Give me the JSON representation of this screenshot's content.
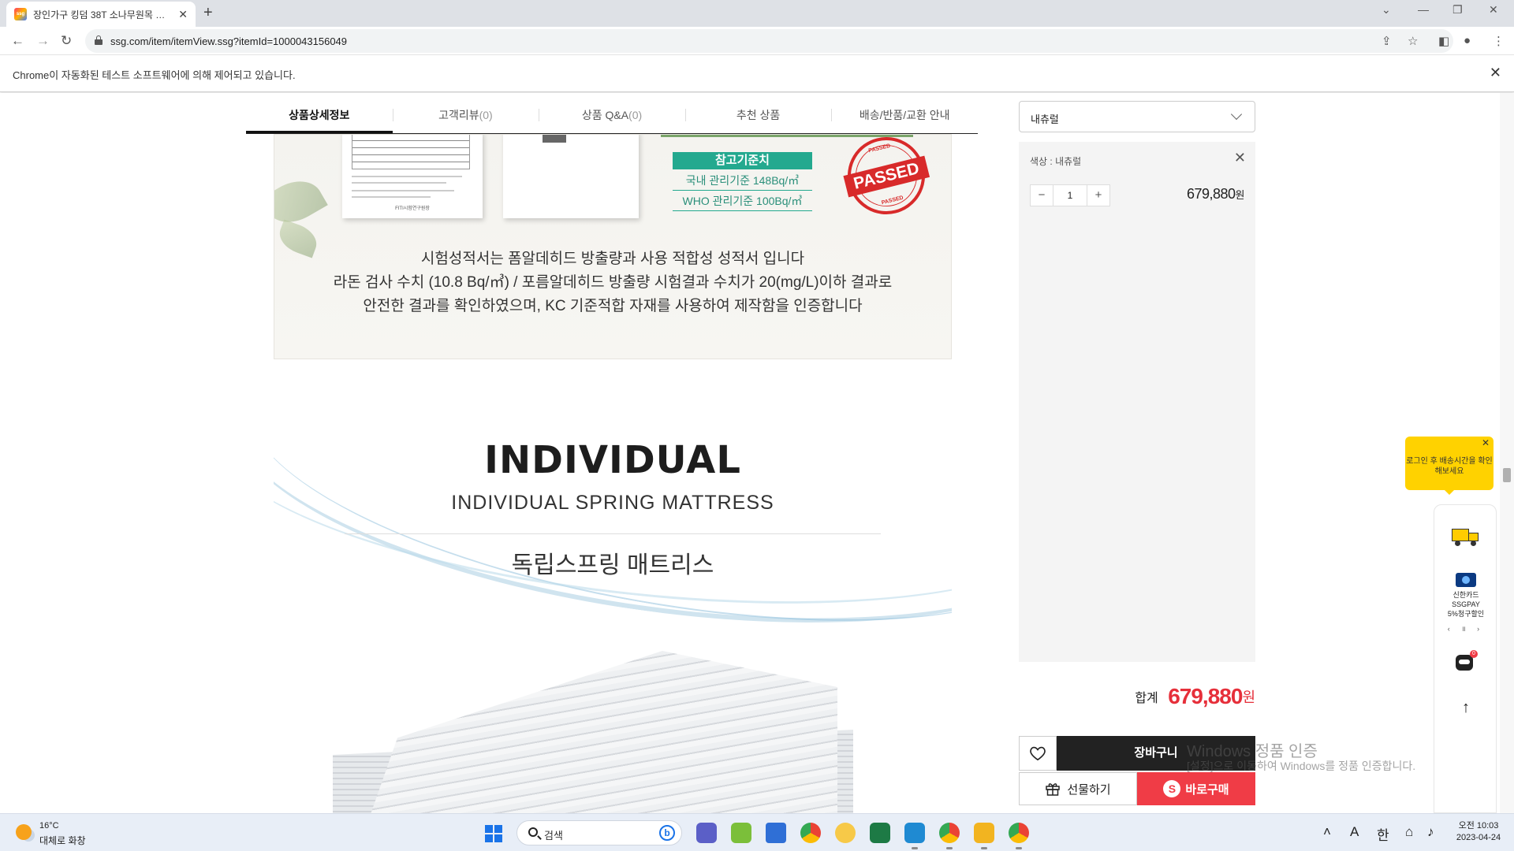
{
  "browser": {
    "tab_title": "장인가구 킹덤 38T 소나무원목 …",
    "favicon_text": "ssg",
    "url": "ssg.com/item/itemView.ssg?itemId=1000043156049",
    "infobar_message": "Chrome이 자동화된 테스트 소프트웨어에 의해 제어되고 있습니다.",
    "icons": [
      "back-icon",
      "forward-icon",
      "reload-icon",
      "lock-icon",
      "share-icon",
      "bookmark-star-icon",
      "side-panel-icon",
      "profile-icon",
      "menu-icon"
    ]
  },
  "product_tabs": [
    {
      "label": "상품상세정보",
      "active": true
    },
    {
      "label": "고객리뷰",
      "count": "(0)"
    },
    {
      "label": "상품 Q&A",
      "count": "(0)"
    },
    {
      "label": "추천 상품"
    },
    {
      "label": "배송/반품/교환 안내"
    }
  ],
  "certificate": {
    "ref_header": "참고기준치",
    "ref_domestic": "국내 관리기준 148Bq/㎥",
    "ref_who": "WHO 관리기준 100Bq/㎥",
    "stamp_text": "PASSED",
    "stamp_ring": "PASSED",
    "doc_footer": "FITI시험연구원장",
    "lines": [
      "시험성적서는 폼알데히드 방출량과 사용 적합성 성적서 입니다",
      "라돈 검사 수치 (10.8 Bq/㎥) / 포름알데히드 방출량 시험결과 수치가 20(mg/L)이하 결과로",
      "안전한 결과를 확인하였으며, KC 기준적합 자재를 사용하여 제작함을 인증합니다"
    ]
  },
  "hero": {
    "title": "INDIVIDUAL",
    "subtitle": "INDIVIDUAL SPRING MATTRESS",
    "korean_title": "독립스프링 매트리스"
  },
  "options": {
    "selected_color": "내츄럴",
    "option_label": "색상 : 내츄럴",
    "quantity": "1",
    "minus": "−",
    "plus": "+",
    "item_price": "679,880",
    "currency": "원",
    "total_label": "합계",
    "total_price": "679,880",
    "cart_button": "장바구니",
    "gift_button": "선물하기",
    "buy_button": "바로구매",
    "buy_badge": "S"
  },
  "side_widget": {
    "tooltip": "로그인 후 배송시간을 확인해보세요",
    "tooltip_close": "✕",
    "card_line1": "신한카드",
    "card_line2": "SSGPAY",
    "card_line3": "5%청구할인",
    "card_nav": "‹ ॥ ›",
    "robot_badge": "0",
    "to_top": "↑"
  },
  "watermark": {
    "line1": "Windows 정품 인증",
    "line2": "[설정]으로 이동하여 Windows를 정품 인증합니다."
  },
  "taskbar": {
    "weather_temp": "16°C",
    "weather_desc": "대체로 화창",
    "search_placeholder": "검색",
    "bing_label": "b",
    "tray_ime_a": "A",
    "tray_ime_han": "한",
    "time": "오전 10:03",
    "date": "2023-04-24"
  },
  "colors": {
    "accent_red": "#e62f3a",
    "buy_red": "#f03c46",
    "teal": "#23a98f",
    "tooltip_yellow": "#ffd200"
  }
}
